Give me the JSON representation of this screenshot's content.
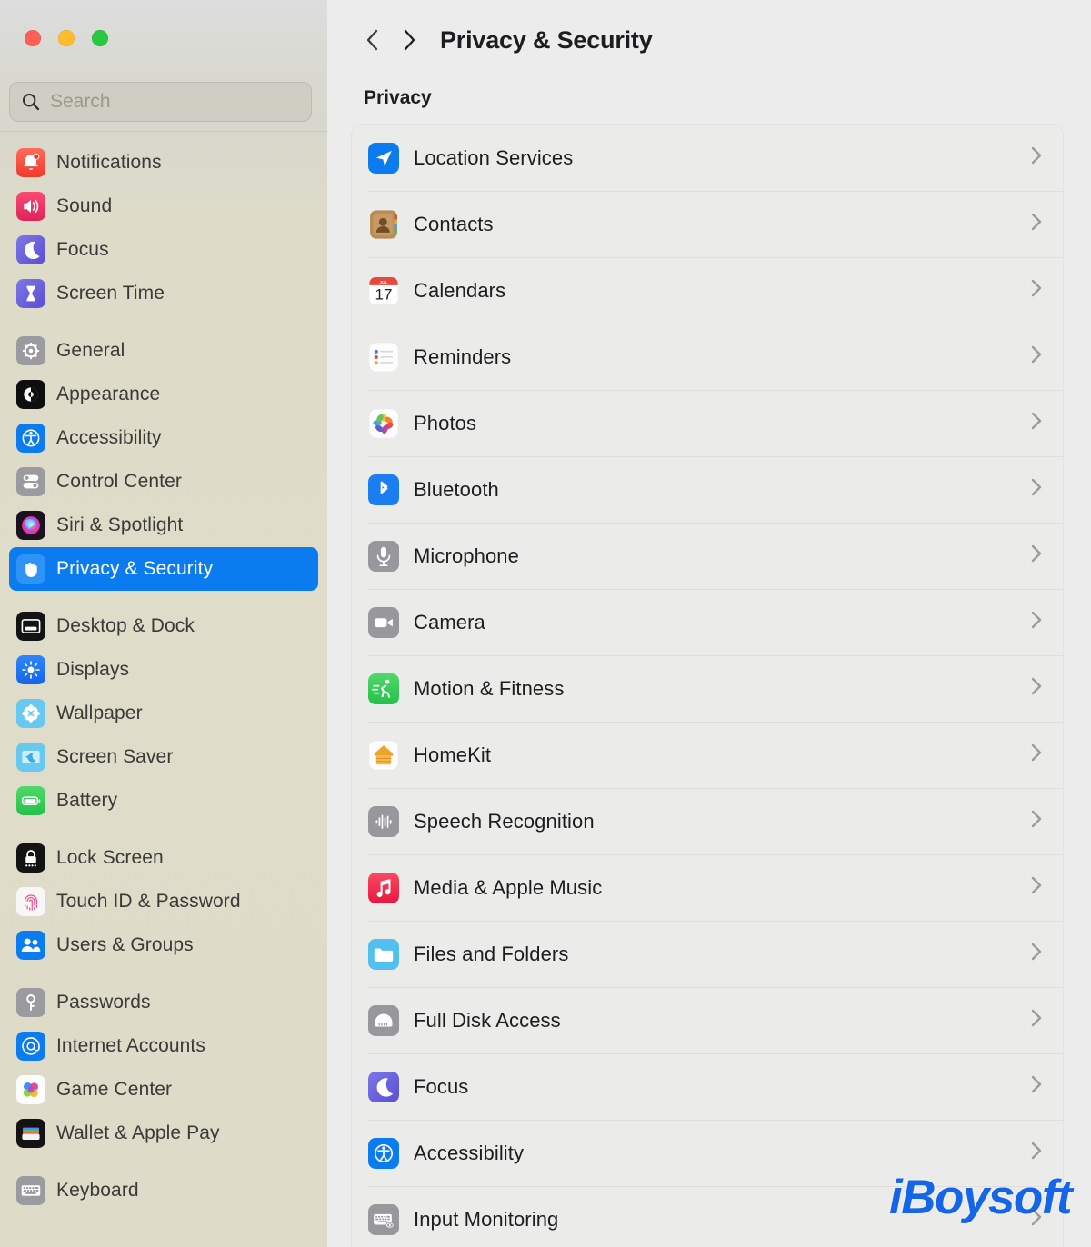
{
  "window": {
    "traffic_lights": [
      {
        "name": "close",
        "color": "#ff5f57"
      },
      {
        "name": "minimize",
        "color": "#ffbd2e"
      },
      {
        "name": "zoom",
        "color": "#28c840"
      }
    ]
  },
  "search": {
    "value": "",
    "placeholder": "Search",
    "icon": "search-icon"
  },
  "sidebar": {
    "groups": [
      {
        "items": [
          {
            "label": "Notifications",
            "icon": "notifications-icon"
          },
          {
            "label": "Sound",
            "icon": "sound-icon"
          },
          {
            "label": "Focus",
            "icon": "focus-icon"
          },
          {
            "label": "Screen Time",
            "icon": "screen-time-icon"
          }
        ]
      },
      {
        "items": [
          {
            "label": "General",
            "icon": "general-icon"
          },
          {
            "label": "Appearance",
            "icon": "appearance-icon"
          },
          {
            "label": "Accessibility",
            "icon": "accessibility-icon"
          },
          {
            "label": "Control Center",
            "icon": "control-center-icon"
          },
          {
            "label": "Siri & Spotlight",
            "icon": "siri-icon"
          },
          {
            "label": "Privacy & Security",
            "icon": "privacy-hand-icon",
            "selected": true
          }
        ]
      },
      {
        "items": [
          {
            "label": "Desktop & Dock",
            "icon": "desktop-dock-icon"
          },
          {
            "label": "Displays",
            "icon": "displays-icon"
          },
          {
            "label": "Wallpaper",
            "icon": "wallpaper-icon"
          },
          {
            "label": "Screen Saver",
            "icon": "screen-saver-icon"
          },
          {
            "label": "Battery",
            "icon": "battery-icon"
          }
        ]
      },
      {
        "items": [
          {
            "label": "Lock Screen",
            "icon": "lock-screen-icon"
          },
          {
            "label": "Touch ID & Password",
            "icon": "touch-id-icon"
          },
          {
            "label": "Users & Groups",
            "icon": "users-groups-icon"
          }
        ]
      },
      {
        "items": [
          {
            "label": "Passwords",
            "icon": "passwords-key-icon"
          },
          {
            "label": "Internet Accounts",
            "icon": "internet-accounts-icon"
          },
          {
            "label": "Game Center",
            "icon": "game-center-icon"
          },
          {
            "label": "Wallet & Apple Pay",
            "icon": "wallet-icon"
          }
        ]
      },
      {
        "items": [
          {
            "label": "Keyboard",
            "icon": "keyboard-icon"
          }
        ]
      }
    ]
  },
  "header": {
    "back_icon": "chevron-left-icon",
    "forward_icon": "chevron-right-icon",
    "title": "Privacy & Security"
  },
  "main": {
    "section_label": "Privacy",
    "rows": [
      {
        "label": "Location Services",
        "icon": "location-services-icon"
      },
      {
        "label": "Contacts",
        "icon": "contacts-icon"
      },
      {
        "label": "Calendars",
        "icon": "calendars-icon",
        "calendar_month": "JUL",
        "calendar_day": "17"
      },
      {
        "label": "Reminders",
        "icon": "reminders-icon"
      },
      {
        "label": "Photos",
        "icon": "photos-icon"
      },
      {
        "label": "Bluetooth",
        "icon": "bluetooth-icon"
      },
      {
        "label": "Microphone",
        "icon": "microphone-icon"
      },
      {
        "label": "Camera",
        "icon": "camera-icon"
      },
      {
        "label": "Motion & Fitness",
        "icon": "motion-fitness-icon"
      },
      {
        "label": "HomeKit",
        "icon": "homekit-icon"
      },
      {
        "label": "Speech Recognition",
        "icon": "speech-recognition-icon"
      },
      {
        "label": "Media & Apple Music",
        "icon": "media-apple-music-icon"
      },
      {
        "label": "Files and Folders",
        "icon": "files-folders-icon"
      },
      {
        "label": "Full Disk Access",
        "icon": "full-disk-access-icon"
      },
      {
        "label": "Focus",
        "icon": "focus-icon"
      },
      {
        "label": "Accessibility",
        "icon": "accessibility-icon"
      },
      {
        "label": "Input Monitoring",
        "icon": "input-monitoring-icon"
      }
    ],
    "row_chevron_icon": "chevron-right-icon"
  },
  "watermark": {
    "text": "iBoysoft",
    "color": "#1565e8"
  },
  "colors": {
    "accent_selected": "#0a7cf0",
    "sidebar_bg": "#dedcc8",
    "main_bg": "#ececec",
    "card_bg": "#ebebe9"
  }
}
